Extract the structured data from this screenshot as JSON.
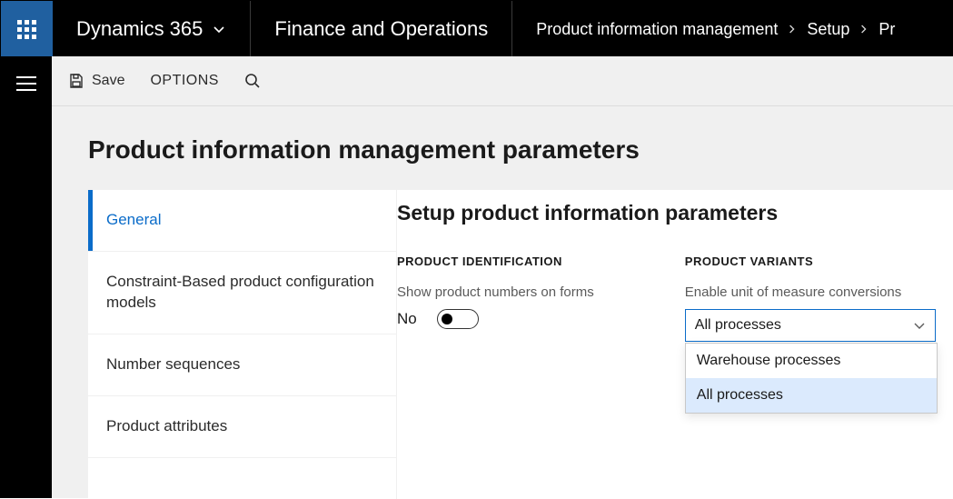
{
  "header": {
    "brand": "Dynamics 365",
    "module": "Finance and Operations",
    "breadcrumb": [
      "Product information management",
      "Setup",
      "Pr"
    ]
  },
  "actionbar": {
    "save_label": "Save",
    "options_label": "OPTIONS"
  },
  "page": {
    "title": "Product information management parameters",
    "section_title": "Setup product information parameters"
  },
  "sidebar": {
    "tabs": [
      {
        "label": "General",
        "active": true
      },
      {
        "label": "Constraint-Based product configuration models",
        "active": false
      },
      {
        "label": "Number sequences",
        "active": false
      },
      {
        "label": "Product attributes",
        "active": false
      }
    ]
  },
  "product_identification": {
    "header": "PRODUCT IDENTIFICATION",
    "toggle_label": "Show product numbers on forms",
    "toggle_value": "No"
  },
  "product_variants": {
    "header": "PRODUCT VARIANTS",
    "select_label": "Enable unit of measure conversions",
    "selected": "All processes",
    "options": [
      "Warehouse processes",
      "All processes"
    ]
  }
}
